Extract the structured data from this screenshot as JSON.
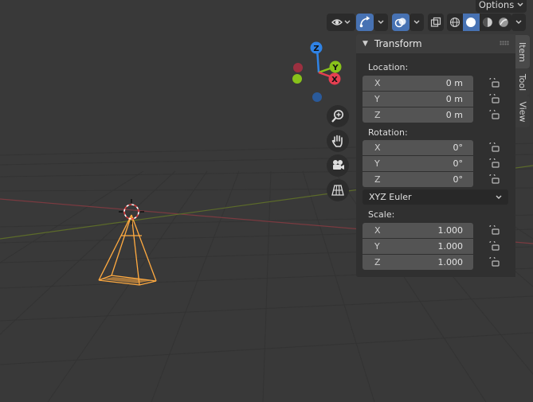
{
  "header": {
    "options_label": "Options"
  },
  "gizmo": {
    "z_label": "Z",
    "y_label": "Y",
    "x_label": "X",
    "colors": {
      "x": "#e53f51",
      "y": "#88c21a",
      "z": "#2f83e6",
      "neg_x": "#9c3040",
      "neg_z": "#2a5a9a"
    }
  },
  "sidebar_tabs": {
    "item": "Item",
    "tool": "Tool",
    "view": "View"
  },
  "transform_panel": {
    "title": "Transform",
    "location": {
      "label": "Location:",
      "x": {
        "axis": "X",
        "value": "0 m"
      },
      "y": {
        "axis": "Y",
        "value": "0 m"
      },
      "z": {
        "axis": "Z",
        "value": "0 m"
      }
    },
    "rotation": {
      "label": "Rotation:",
      "x": {
        "axis": "X",
        "value": "0°"
      },
      "y": {
        "axis": "Y",
        "value": "0°"
      },
      "z": {
        "axis": "Z",
        "value": "0°"
      }
    },
    "rotation_mode": "XYZ Euler",
    "scale": {
      "label": "Scale:",
      "x": {
        "axis": "X",
        "value": "1.000"
      },
      "y": {
        "axis": "Y",
        "value": "1.000"
      },
      "z": {
        "axis": "Z",
        "value": "1.000"
      }
    }
  },
  "theme": {
    "accent": "#4772b3",
    "selection": "#ffaa40",
    "background": "#393939"
  }
}
